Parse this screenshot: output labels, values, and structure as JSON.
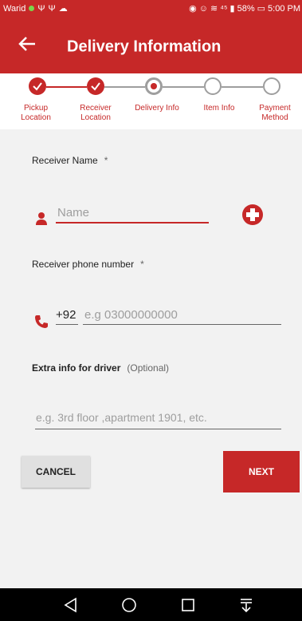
{
  "status_bar": {
    "carrier": "Warid",
    "network": "⁴⁵",
    "battery": "58%",
    "time": "5:00 PM"
  },
  "app_bar": {
    "title": "Delivery Information"
  },
  "stepper": {
    "steps": [
      {
        "label": "Pickup Location",
        "state": "done"
      },
      {
        "label": "Receiver Location",
        "state": "done"
      },
      {
        "label": "Delivery Info",
        "state": "active"
      },
      {
        "label": "Item Info",
        "state": "todo"
      },
      {
        "label": "Payment Method",
        "state": "todo"
      }
    ]
  },
  "form": {
    "receiver_name_label": "Receiver Name",
    "required_mark": "*",
    "name_placeholder": "Name",
    "phone_label": "Receiver phone number",
    "country_code": "+92",
    "phone_placeholder": "e.g 03000000000",
    "extra_label": "Extra info for driver",
    "extra_optional": "(Optional)",
    "extra_placeholder": "e.g. 3rd floor ,apartment 1901, etc."
  },
  "buttons": {
    "cancel": "CANCEL",
    "next": "NEXT"
  },
  "colors": {
    "primary": "#c62828",
    "background": "#f2f2f2"
  }
}
